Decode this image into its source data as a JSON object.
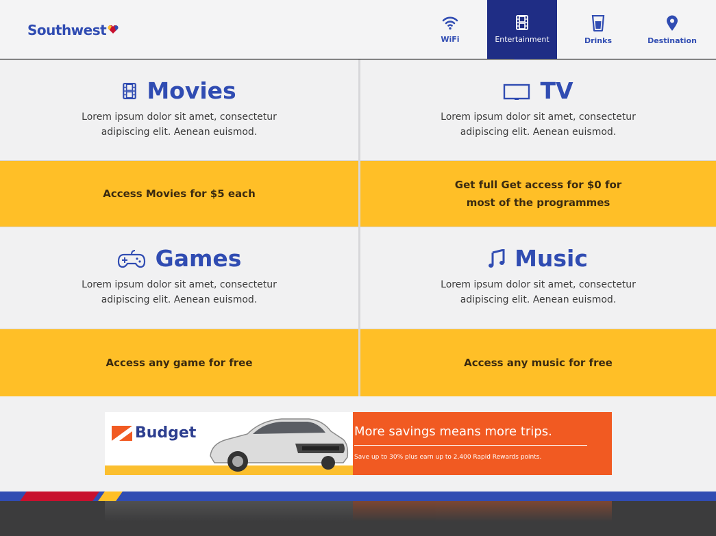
{
  "brand": {
    "logo_text": "Southwest",
    "colors": {
      "primary": "#304cb2",
      "accent": "#ffbf27",
      "red": "#c8102e",
      "active_nav": "#1f2d85"
    }
  },
  "nav": {
    "items": [
      {
        "label": "WiFi",
        "icon": "wifi-icon"
      },
      {
        "label": "Entertainment",
        "icon": "film-icon",
        "active": true
      },
      {
        "label": "Drinks",
        "icon": "drink-icon"
      },
      {
        "label": "Destination",
        "icon": "map-pin-icon"
      }
    ]
  },
  "sections": {
    "movies": {
      "title": "Movies",
      "icon": "film-icon",
      "description": "Lorem ipsum dolor sit amet, consectetur adipiscing elit. Aenean euismod.",
      "cta": "Access Movies for $5 each"
    },
    "tv": {
      "title": "TV",
      "icon": "tv-icon",
      "description": "Lorem ipsum dolor sit amet, consectetur adipiscing elit. Aenean euismod.",
      "cta": "Get full Get access for $0 for most of the programmes"
    },
    "games": {
      "title": "Games",
      "icon": "gamepad-icon",
      "description": "Lorem ipsum dolor sit amet, consectetur adipiscing elit. Aenean euismod.",
      "cta": "Access any game for free"
    },
    "music": {
      "title": "Music",
      "icon": "music-note-icon",
      "description": "Lorem ipsum dolor sit amet, consectetur adipiscing elit. Aenean euismod.",
      "cta": "Access any music for free"
    }
  },
  "ad": {
    "brand": "Budget",
    "headline": "More savings means more trips.",
    "subtext": "Save up to 30% plus earn up to 2,400 Rapid Rewards points."
  }
}
